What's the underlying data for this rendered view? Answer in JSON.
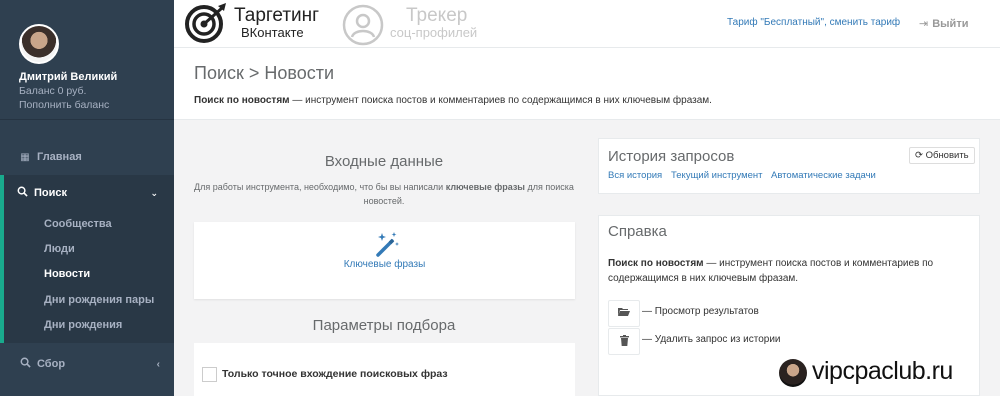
{
  "sidebar": {
    "user_name": "Дмитрий Великий",
    "balance": "Баланс 0 руб.",
    "topup": "Пополнить баланс",
    "home": "Главная",
    "search": "Поиск",
    "search_items": [
      "Сообщества",
      "Люди",
      "Новости",
      "Дни рождения пары",
      "Дни рождения"
    ],
    "active_item": "Новости",
    "collect": "Сбор"
  },
  "topbar": {
    "brand1_title": "Таргетинг",
    "brand1_sub": "ВКонтакте",
    "brand2_title": "Трекер",
    "brand2_sub": "соц-профилей",
    "tariff": "Тариф \"Бесплатный\", сменить тариф",
    "logout": "Выйти"
  },
  "heading": {
    "title": "Поиск > Новости",
    "desc_bold": "Поиск по новостям",
    "desc_rest": " — инструмент поиска постов и комментариев по содержащимся в них ключевым фразам."
  },
  "input": {
    "title": "Входные данные",
    "note_pre": "Для работы инструмента, необходимо, что бы вы написали ",
    "note_bold": "ключевые фразы",
    "note_post": " для поиска новостей.",
    "keyword_label": "Ключевые фразы"
  },
  "params": {
    "title": "Параметры подбора",
    "exact_match_label": "Только точное вхождение поисковых фраз",
    "exact_match_checked": false
  },
  "history": {
    "title": "История запросов",
    "refresh": "Обновить",
    "links": [
      "Вся история",
      "Текущий инструмент",
      "Автоматические задачи"
    ]
  },
  "help": {
    "title": "Справка",
    "text_bold": "Поиск по новостям",
    "text_rest": " — инструмент поиска постов и комментариев по содержащимся в них ключевым фразам.",
    "view_results": "— Просмотр результатов",
    "delete_request": "— Удалить запрос из истории"
  },
  "watermark": "vipcpaclub.ru",
  "colors": {
    "sidebar_bg": "#2f4050",
    "accent": "#19aa8d",
    "link": "#337ab7"
  }
}
